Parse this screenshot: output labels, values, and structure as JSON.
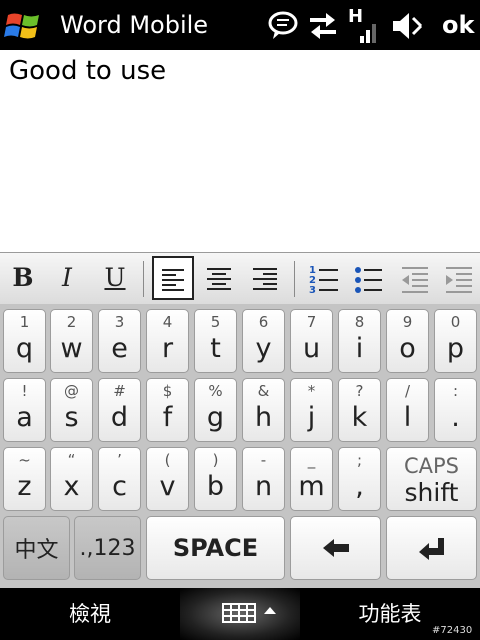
{
  "title_bar": {
    "app_title": "Word Mobile",
    "ok_label": "ok",
    "signal_label": "H"
  },
  "document": {
    "text": "Good to use"
  },
  "format_toolbar": {
    "bold": "B",
    "italic": "I",
    "underline": "U",
    "numbered_list_digits": [
      "1",
      "2",
      "3"
    ]
  },
  "keyboard": {
    "rows": [
      [
        {
          "sec": "1",
          "pri": "q"
        },
        {
          "sec": "2",
          "pri": "w"
        },
        {
          "sec": "3",
          "pri": "e"
        },
        {
          "sec": "4",
          "pri": "r"
        },
        {
          "sec": "5",
          "pri": "t"
        },
        {
          "sec": "6",
          "pri": "y"
        },
        {
          "sec": "7",
          "pri": "u"
        },
        {
          "sec": "8",
          "pri": "i"
        },
        {
          "sec": "9",
          "pri": "o"
        },
        {
          "sec": "0",
          "pri": "p"
        }
      ],
      [
        {
          "sec": "!",
          "pri": "a"
        },
        {
          "sec": "@",
          "pri": "s"
        },
        {
          "sec": "#",
          "pri": "d"
        },
        {
          "sec": "$",
          "pri": "f"
        },
        {
          "sec": "%",
          "pri": "g"
        },
        {
          "sec": "&",
          "pri": "h"
        },
        {
          "sec": "*",
          "pri": "j"
        },
        {
          "sec": "?",
          "pri": "k"
        },
        {
          "sec": "/",
          "pri": "l"
        },
        {
          "sec": ":",
          "pri": "."
        }
      ],
      [
        {
          "sec": "~",
          "pri": "z"
        },
        {
          "sec": "“",
          "pri": "x"
        },
        {
          "sec": "’",
          "pri": "c"
        },
        {
          "sec": "(",
          "pri": "v"
        },
        {
          "sec": ")",
          "pri": "b"
        },
        {
          "sec": "-",
          "pri": "n"
        },
        {
          "sec": "_",
          "pri": "m"
        },
        {
          "sec": ";",
          "pri": ","
        }
      ]
    ],
    "caps_label": "CAPS",
    "shift_label": "shift",
    "chinese_label": "中文",
    "numsym_label": ".,123",
    "space_label": "SPACE"
  },
  "softkeys": {
    "left": "檢視",
    "right": "功能表"
  },
  "watermark": "#72430",
  "colors": {
    "titlebar_bg": "#000000",
    "keyboard_bg": "#c4c4c4",
    "key_face": "#ffffff",
    "dark_key_face": "#bdbdbd"
  }
}
